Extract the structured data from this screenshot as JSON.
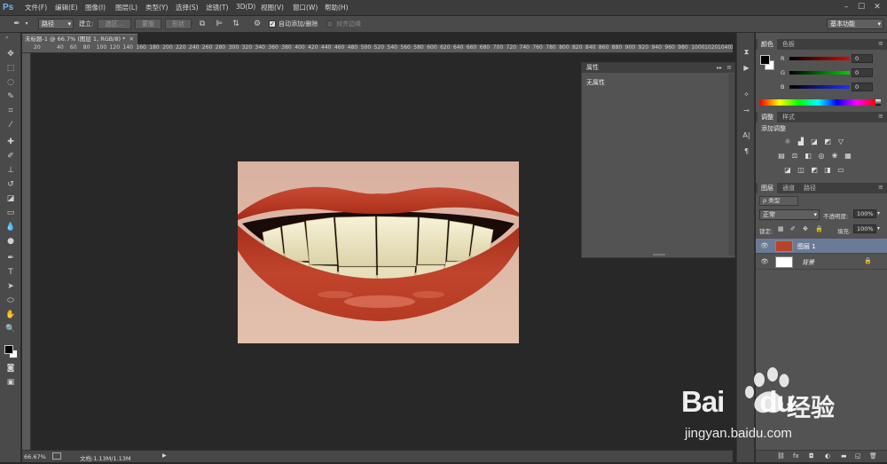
{
  "app": {
    "logo": "Ps"
  },
  "menu": [
    "文件(F)",
    "编辑(E)",
    "图像(I)",
    "图层(L)",
    "类型(Y)",
    "选择(S)",
    "滤镜(T)",
    "3D(D)",
    "视图(V)",
    "窗口(W)",
    "帮助(H)"
  ],
  "window_controls": [
    "–",
    "☐",
    "✕"
  ],
  "options": {
    "mode": "路径",
    "build_label": "建立:",
    "selection_btn": "选区...",
    "mask_btn": "蒙版",
    "shape_btn": "形状",
    "auto_add_delete": "自动添加/删除",
    "align_edges": "对齐边缘",
    "workspace": "基本功能"
  },
  "document": {
    "tab_title": "未标题-1 @ 66.7% (图层 1, RGB/8) *",
    "zoom": "66.67%",
    "doc_info": "文档:1.13M/1.13M"
  },
  "ruler_numbers": [
    "0",
    "20",
    "40",
    "60",
    "80",
    "100",
    "120",
    "140",
    "160",
    "180",
    "200",
    "220",
    "240",
    "260",
    "280",
    "300",
    "320",
    "340",
    "360",
    "380",
    "400",
    "420",
    "440",
    "460",
    "480",
    "500",
    "520",
    "540",
    "560",
    "580",
    "600",
    "620",
    "640",
    "660",
    "680",
    "700",
    "720",
    "740",
    "760",
    "780",
    "800",
    "820",
    "840",
    "860",
    "880",
    "900",
    "920",
    "940",
    "960",
    "980",
    "1000",
    "1020",
    "1040",
    "1060",
    "1080",
    "1100"
  ],
  "ruler_start": "20",
  "properties_panel": {
    "title": "属性",
    "empty_text": "无属性"
  },
  "color_panel": {
    "tabs": [
      "颜色",
      "色板"
    ],
    "channels": [
      {
        "label": "R",
        "value": "0"
      },
      {
        "label": "G",
        "value": "0"
      },
      {
        "label": "B",
        "value": "0"
      }
    ]
  },
  "adjust_panel": {
    "tabs": [
      "调整",
      "样式"
    ],
    "heading": "添加调整"
  },
  "layers_panel": {
    "tabs": [
      "图层",
      "通道",
      "路径"
    ],
    "filter_kind": "ρ 类型",
    "blend_mode": "正常",
    "opacity_label": "不透明度:",
    "opacity_value": "100%",
    "lock_label": "锁定:",
    "fill_label": "填充:",
    "fill_value": "100%",
    "layers": [
      {
        "name": "图层 1",
        "selected": true
      },
      {
        "name": "背景",
        "selected": false
      }
    ]
  },
  "watermark": {
    "brand": "Bai",
    "brand2": "du",
    "cn": "经验",
    "url": "jingyan.baidu.com"
  },
  "colors": {
    "accent": "#3f82d0",
    "lip": "#b8321e",
    "teeth": "#eee6c4"
  }
}
